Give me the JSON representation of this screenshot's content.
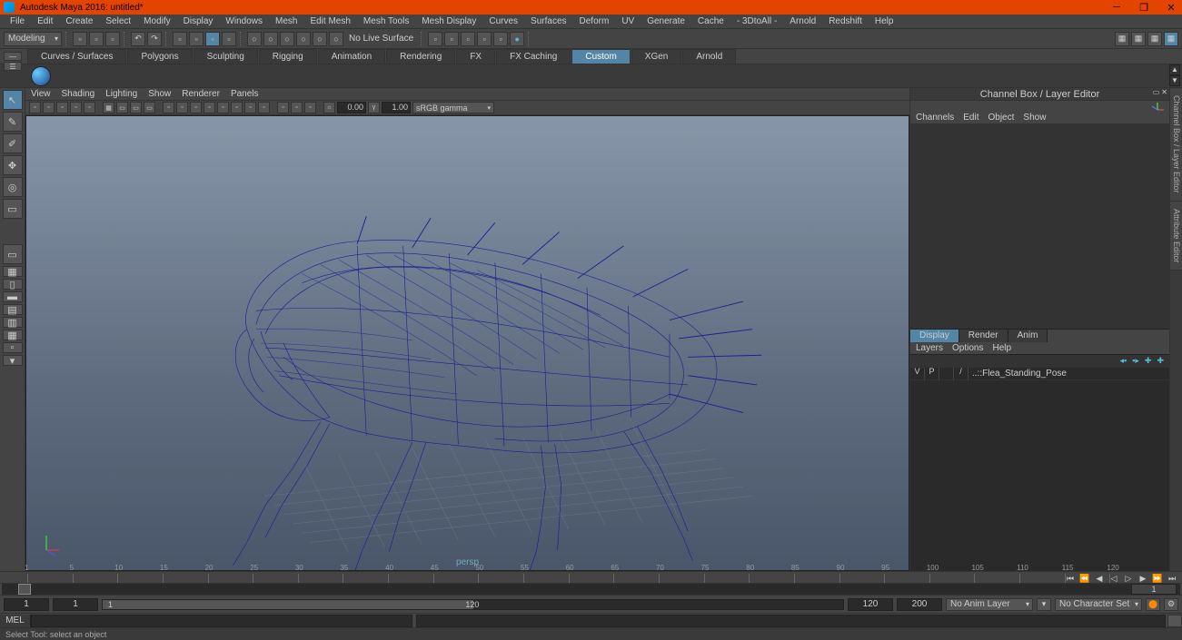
{
  "title": "Autodesk Maya 2016: untitled*",
  "menubar": [
    "File",
    "Edit",
    "Create",
    "Select",
    "Modify",
    "Display",
    "Windows",
    "Mesh",
    "Edit Mesh",
    "Mesh Tools",
    "Mesh Display",
    "Curves",
    "Surfaces",
    "Deform",
    "UV",
    "Generate",
    "Cache",
    "- 3DtoAll -",
    "Arnold",
    "Redshift",
    "Help"
  ],
  "modeDropdown": "Modeling",
  "liveSurface": "No Live Surface",
  "shelfTabs": [
    "Curves / Surfaces",
    "Polygons",
    "Sculpting",
    "Rigging",
    "Animation",
    "Rendering",
    "FX",
    "FX Caching",
    "Custom",
    "XGen",
    "Arnold"
  ],
  "shelfActive": "Custom",
  "panelMenus": [
    "View",
    "Shading",
    "Lighting",
    "Show",
    "Renderer",
    "Panels"
  ],
  "panelNum1": "0.00",
  "panelNum2": "1.00",
  "colorSpace": "sRGB gamma",
  "viewportLabel": "persp",
  "channelBox": {
    "title": "Channel Box / Layer Editor",
    "menus": [
      "Channels",
      "Edit",
      "Object",
      "Show"
    ],
    "layerTabs": [
      "Display",
      "Render",
      "Anim"
    ],
    "layerMenus": [
      "Layers",
      "Options",
      "Help"
    ],
    "layerRow": {
      "c1": "V",
      "c2": "P",
      "c3": "",
      "c4": "/",
      "name": "..::Flea_Standing_Pose"
    }
  },
  "sideTabs": [
    "Channel Box / Layer Editor",
    "Attribute Editor"
  ],
  "timeline": {
    "ticks": [
      "1",
      "5",
      "10",
      "15",
      "20",
      "25",
      "30",
      "35",
      "40",
      "45",
      "50",
      "55",
      "60",
      "65",
      "70",
      "75",
      "80",
      "85",
      "90",
      "95",
      "100",
      "105",
      "110",
      "115",
      "120"
    ],
    "current": "1",
    "rangeStart": "1",
    "rangeInner": "1",
    "rangeLabel1": "1",
    "rangeLabel2": "120",
    "rangeEnd1": "120",
    "rangeEnd2": "200",
    "animLayer": "No Anim Layer",
    "charSet": "No Character Set"
  },
  "cmd": {
    "lang": "MEL"
  },
  "helpline": "Select Tool: select an object"
}
